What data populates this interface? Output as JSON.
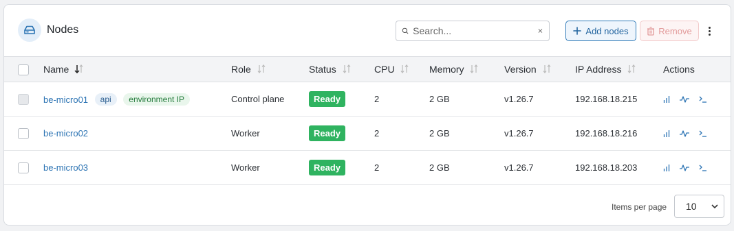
{
  "header": {
    "title": "Nodes",
    "search_placeholder": "Search...",
    "add_label": "Add nodes",
    "remove_label": "Remove"
  },
  "columns": {
    "name": "Name",
    "role": "Role",
    "status": "Status",
    "cpu": "CPU",
    "memory": "Memory",
    "version": "Version",
    "ip": "IP Address",
    "actions": "Actions"
  },
  "rows": [
    {
      "name": "be-micro01",
      "tags": [
        "api",
        "environment IP"
      ],
      "role": "Control plane",
      "status": "Ready",
      "cpu": "2",
      "memory": "2 GB",
      "version": "v1.26.7",
      "ip": "192.168.18.215"
    },
    {
      "name": "be-micro02",
      "tags": [],
      "role": "Worker",
      "status": "Ready",
      "cpu": "2",
      "memory": "2 GB",
      "version": "v1.26.7",
      "ip": "192.168.18.216"
    },
    {
      "name": "be-micro03",
      "tags": [],
      "role": "Worker",
      "status": "Ready",
      "cpu": "2",
      "memory": "2 GB",
      "version": "v1.26.7",
      "ip": "192.168.18.203"
    }
  ],
  "footer": {
    "items_per_page_label": "Items per page",
    "items_per_page_value": "10"
  },
  "colors": {
    "accent": "#2b73b3",
    "ready": "#2fb360",
    "remove": "#e29a9a"
  },
  "icons": {
    "header": "server-drive-icon",
    "search": "search-icon",
    "clear": "close-icon",
    "add": "plus-icon",
    "remove": "trash-icon",
    "menu": "kebab-menu-icon",
    "sort": "sort-arrows-icon",
    "row_actions": [
      "bar-chart-icon",
      "activity-pulse-icon",
      "terminal-icon"
    ]
  }
}
